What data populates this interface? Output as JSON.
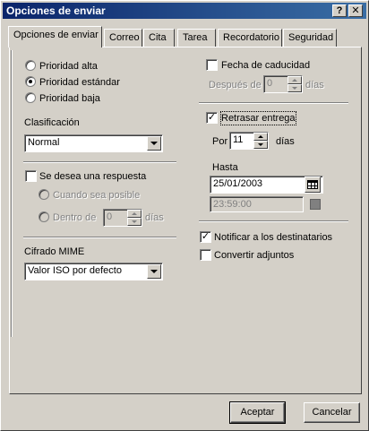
{
  "window": {
    "title": "Opciones de enviar",
    "help_btn": "?",
    "close_btn": "✕"
  },
  "tabs": [
    {
      "label": "Opciones de enviar"
    },
    {
      "label": "Correo"
    },
    {
      "label": "Cita"
    },
    {
      "label": "Tarea"
    },
    {
      "label": "Recordatorio"
    },
    {
      "label": "Seguridad"
    }
  ],
  "priority": {
    "high": "Prioridad alta",
    "standard": "Prioridad estándar",
    "low": "Prioridad baja",
    "selected": "standard"
  },
  "classification": {
    "label": "Clasificación",
    "value": "Normal"
  },
  "reply": {
    "checkbox_label": "Se desea una respuesta",
    "when_possible": "Cuando sea posible",
    "within": "Dentro de",
    "within_value": "0",
    "days": "días"
  },
  "mime": {
    "label": "Cifrado MIME",
    "value": "Valor ISO por defecto"
  },
  "expiration": {
    "checkbox_label": "Fecha de caducidad",
    "after": "Después de",
    "after_value": "0",
    "days": "días"
  },
  "delay": {
    "checkbox_label": "Retrasar entrega",
    "checked": true,
    "by": "Por",
    "by_value": "11",
    "days": "días",
    "until": "Hasta",
    "date": "25/01/2003",
    "time": "23:59:00"
  },
  "notify": {
    "label": "Notificar a los destinatarios",
    "checked": true
  },
  "convert": {
    "label": "Convertir adjuntos",
    "checked": false
  },
  "buttons": {
    "accept": "Aceptar",
    "cancel": "Cancelar"
  },
  "check_mark": "✓"
}
